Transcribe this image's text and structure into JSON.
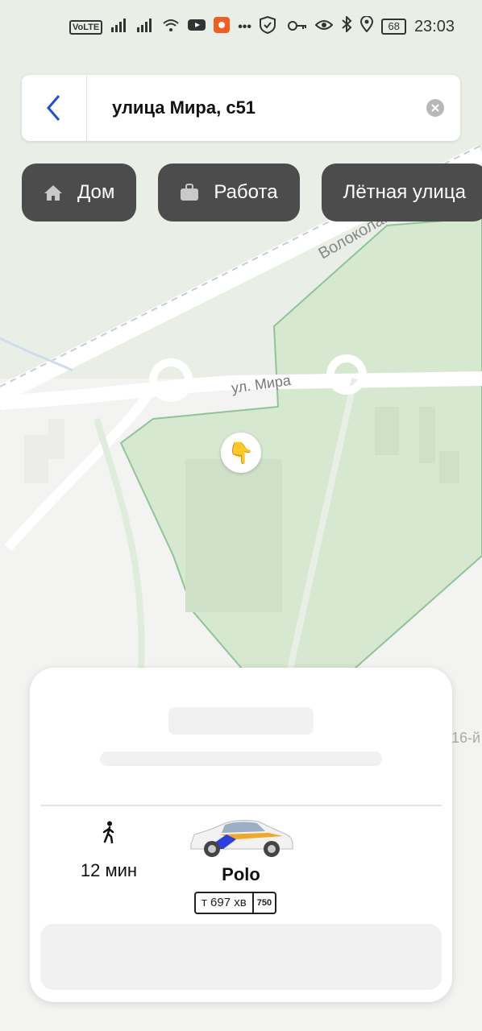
{
  "status_bar": {
    "time": "23:03",
    "battery": "68",
    "volte": "VoLTE",
    "icons_left": [
      "volte-icon",
      "signal-icon",
      "signal-icon",
      "wifi-icon",
      "youtube-icon",
      "app-icon",
      "more-icon",
      "shield-icon"
    ],
    "icons_right": [
      "key-icon",
      "eye-icon",
      "bluetooth-icon",
      "location-icon"
    ]
  },
  "search": {
    "query": "улица Мира, с51"
  },
  "chips": [
    {
      "label": "Дом",
      "icon": "home-icon"
    },
    {
      "label": "Работа",
      "icon": "briefcase-icon"
    },
    {
      "label": "Лётная улица",
      "icon": ""
    }
  ],
  "map": {
    "street_label": "ул. Мира",
    "highway_label": "Волоколамское ш.",
    "side_label": "16-й",
    "pin_icon": "👇"
  },
  "card": {
    "walk_time": "12 мин",
    "car_model": "Polo",
    "plate_number": "т 697 хв",
    "plate_region": "750"
  },
  "colors": {
    "map_background": "#f2f2f0",
    "park_fill": "#d6e8d0",
    "chip_background": "#4c4c4c",
    "back_arrow": "#1e4fd8"
  }
}
